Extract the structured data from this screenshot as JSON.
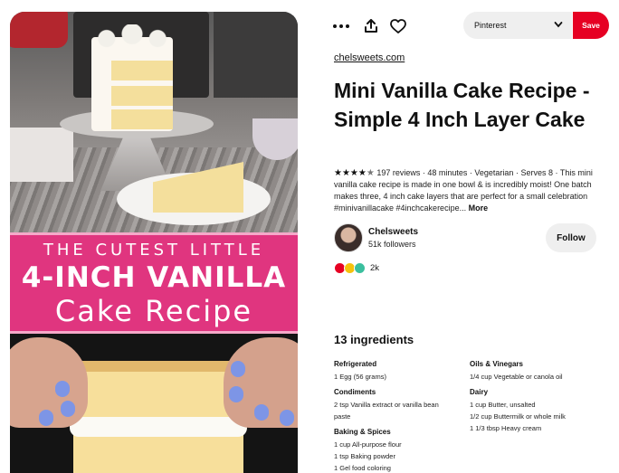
{
  "toolbar": {
    "more_icon": "more-horizontal-icon",
    "share_icon": "share-upload-icon",
    "like_icon": "heart-outline-icon"
  },
  "board_selector": {
    "selected": "Pinterest",
    "icon": "chevron-down-icon"
  },
  "save_button": {
    "label": "Save",
    "color": "#e60023"
  },
  "pin_image": {
    "banner_line1": "THE CUTEST LITTLE",
    "banner_line2": "4-INCH VANILLA",
    "banner_line3": "Cake Recipe",
    "banner_color": "#e0357f"
  },
  "pin": {
    "source": "chelsweets.com",
    "title": "Mini Vanilla Cake Recipe - Simple 4 Inch Layer Cake",
    "rating_stars": 4.5,
    "reviews": "197 reviews",
    "duration": "48 minutes",
    "diet": "Vegetarian",
    "serves": "Serves 8",
    "description": "This mini vanilla cake recipe is made in one bowl & is incredibly moist! One batch makes three, 4 inch cake layers that are perfect for a small celebration #minivanillacake #4inchcakerecipe...",
    "more_label": "More"
  },
  "creator": {
    "name": "Chelsweets",
    "followers": "51k followers",
    "follow_label": "Follow"
  },
  "reactions": {
    "count": "2k",
    "icons": [
      "heart-reaction-icon",
      "haha-reaction-icon",
      "wow-reaction-icon"
    ]
  },
  "ingredients": {
    "title": "13 ingredients",
    "left_groups": [
      {
        "name": "Refrigerated",
        "items": [
          "1 Egg (56 grams)"
        ]
      },
      {
        "name": "Condiments",
        "items": [
          "2 tsp Vanilla extract or vanilla bean paste"
        ]
      },
      {
        "name": "Baking & Spices",
        "items": [
          "1 cup All-purpose flour",
          "1 tsp Baking powder",
          "1 Gel food coloring"
        ]
      }
    ],
    "right_groups": [
      {
        "name": "Oils & Vinegars",
        "items": [
          "1/4 cup Vegetable or canola oil"
        ]
      },
      {
        "name": "Dairy",
        "items": [
          "1 cup Butter, unsalted",
          "1/2 cup Buttermilk or whole milk",
          "1 1/3 tbsp Heavy cream"
        ]
      }
    ]
  }
}
